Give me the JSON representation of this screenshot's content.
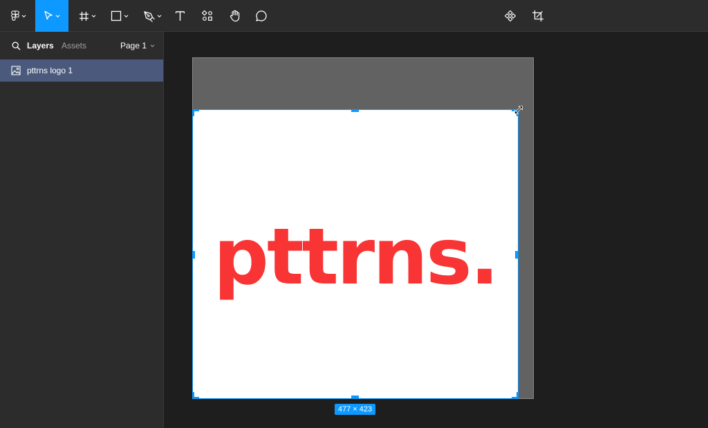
{
  "toolbar": {
    "tools": [
      "figma-menu",
      "move",
      "frame",
      "shape",
      "pen",
      "text",
      "resources",
      "hand",
      "comment"
    ],
    "active_tool": "move",
    "right_tools": [
      "component",
      "crop"
    ]
  },
  "sidebar": {
    "tab_layers": "Layers",
    "tab_assets": "Assets",
    "page_label": "Page 1",
    "layers": [
      {
        "label": "pttrns logo 1",
        "icon": "image-icon",
        "selected": true
      }
    ]
  },
  "canvas": {
    "logo_text": "pttrns.",
    "size_badge": "477 × 423"
  },
  "colors": {
    "accent": "#0d99ff",
    "logo_red": "#f83434",
    "selected_layer": "#4b5a7c",
    "panel": "#2c2c2c",
    "canvas": "#1e1e1e"
  }
}
